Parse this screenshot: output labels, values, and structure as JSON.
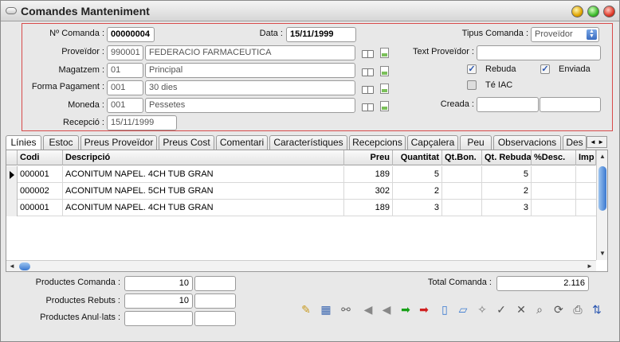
{
  "window": {
    "title": "Comandes Manteniment"
  },
  "header": {
    "num_comanda_label": "Nº Comanda :",
    "num_comanda_value": "00000004",
    "data_label": "Data :",
    "data_value": "15/11/1999",
    "proveidor_label": "Proveïdor :",
    "proveidor_code": "990001",
    "proveidor_name": "FEDERACIO FARMACEUTICA",
    "magatzem_label": "Magatzem :",
    "magatzem_code": "01",
    "magatzem_name": "Principal",
    "forma_pagament_label": "Forma Pagament :",
    "forma_pagament_code": "001",
    "forma_pagament_name": "30 dies",
    "moneda_label": "Moneda :",
    "moneda_code": "001",
    "moneda_name": "Pessetes",
    "recepcio_label": "Recepció :",
    "recepcio_value": "15/11/1999",
    "tipus_comanda_label": "Tipus Comanda :",
    "tipus_comanda_value": "Proveïdor",
    "text_proveidor_label": "Text Proveïdor :",
    "text_proveidor_value": "",
    "rebuda_label": "Rebuda",
    "enviada_label": "Enviada",
    "te_iac_label": "Té IAC",
    "creada_label": "Creada :",
    "check_mark": "✓"
  },
  "tabs": [
    "Línies",
    "Estoc",
    "Preus Proveïdor",
    "Preus Cost",
    "Comentari",
    "Característiques",
    "Recepcions",
    "Capçalera",
    "Peu",
    "Observacions",
    "Des"
  ],
  "tab_arrows": "◄ ►",
  "grid": {
    "columns": [
      "Codi",
      "Descripció",
      "Preu",
      "Quantitat",
      "Qt.Bon.",
      "Qt. Rebuda",
      "%Desc.",
      "Imp"
    ],
    "rows": [
      {
        "codi": "000001",
        "descripcio": "ACONITUM NAPEL. 4CH TUB GRAN",
        "preu": "189",
        "quantitat": "5",
        "qtbon": "",
        "qtrebuda": "5",
        "desc": ""
      },
      {
        "codi": "000002",
        "descripcio": "ACONITUM NAPEL. 5CH TUB GRAN",
        "preu": "302",
        "quantitat": "2",
        "qtbon": "",
        "qtrebuda": "2",
        "desc": ""
      },
      {
        "codi": "000001",
        "descripcio": "ACONITUM NAPEL. 4CH TUB GRAN",
        "preu": "189",
        "quantitat": "3",
        "qtbon": "",
        "qtrebuda": "3",
        "desc": ""
      }
    ]
  },
  "footer": {
    "productes_comanda_label": "Productes Comanda :",
    "productes_comanda_value": "10",
    "productes_rebuts_label": "Productes Rebuts :",
    "productes_rebuts_value": "10",
    "productes_anulats_label": "Productes Anul·lats :",
    "productes_anulats_value": "",
    "total_comanda_label": "Total Comanda :",
    "total_comanda_value": "2.116"
  },
  "toolbar": [
    {
      "name": "eraser-icon",
      "glyph": "✎",
      "color": "#c89a20"
    },
    {
      "name": "grid-icon",
      "glyph": "▦",
      "color": "#3a66b0"
    },
    {
      "name": "binoculars-icon",
      "glyph": "⚯",
      "color": "#666"
    },
    {
      "name": "first-record-icon",
      "glyph": "◀",
      "color": "#888"
    },
    {
      "name": "prev-record-icon",
      "glyph": "◀",
      "color": "#888"
    },
    {
      "name": "next-record-icon",
      "glyph": "➡",
      "color": "#18a018"
    },
    {
      "name": "last-record-icon",
      "glyph": "➡",
      "color": "#d02020"
    },
    {
      "name": "new-record-icon",
      "glyph": "▯",
      "color": "#3a7ad0"
    },
    {
      "name": "edit-record-icon",
      "glyph": "▱",
      "color": "#3a7ad0"
    },
    {
      "name": "delete-record-icon",
      "glyph": "✧",
      "color": "#777"
    },
    {
      "name": "confirm-icon",
      "glyph": "✓",
      "color": "#555"
    },
    {
      "name": "cancel-icon",
      "glyph": "✕",
      "color": "#555"
    },
    {
      "name": "search-icon",
      "glyph": "⌕",
      "color": "#555"
    },
    {
      "name": "refresh-icon",
      "glyph": "⟳",
      "color": "#555"
    },
    {
      "name": "print-icon",
      "glyph": "⎙",
      "color": "#555"
    },
    {
      "name": "sort-az-icon",
      "glyph": "⇅",
      "color": "#2a56b0"
    }
  ]
}
